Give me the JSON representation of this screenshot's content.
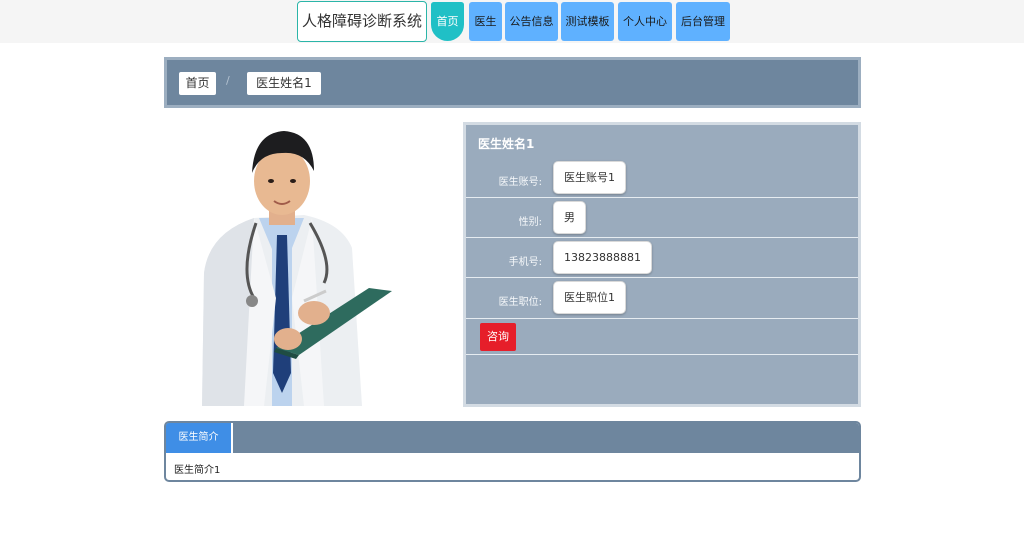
{
  "header": {
    "brand": "人格障碍诊断系统",
    "nav": [
      {
        "label": "首页",
        "active": true
      },
      {
        "label": "医生"
      },
      {
        "label": "公告信息"
      },
      {
        "label": "测试模板"
      },
      {
        "label": "个人中心"
      },
      {
        "label": "后台管理"
      }
    ]
  },
  "breadcrumb": {
    "home": "首页",
    "separator": "/",
    "current": "医生姓名1"
  },
  "doctor": {
    "name": "医生姓名1",
    "fields": [
      {
        "label": "医生账号:",
        "value": "医生账号1"
      },
      {
        "label": "性别:",
        "value": "男"
      },
      {
        "label": "手机号:",
        "value": "13823888881"
      },
      {
        "label": "医生职位:",
        "value": "医生职位1"
      }
    ],
    "consult_label": "咨询"
  },
  "intro": {
    "tab_label": "医生简介",
    "text": "医生简介1"
  },
  "colors": {
    "accent_active": "#20c0c6",
    "nav_button": "#5fb1ff",
    "panel": "#6e869e",
    "consult": "#e61e2a"
  }
}
